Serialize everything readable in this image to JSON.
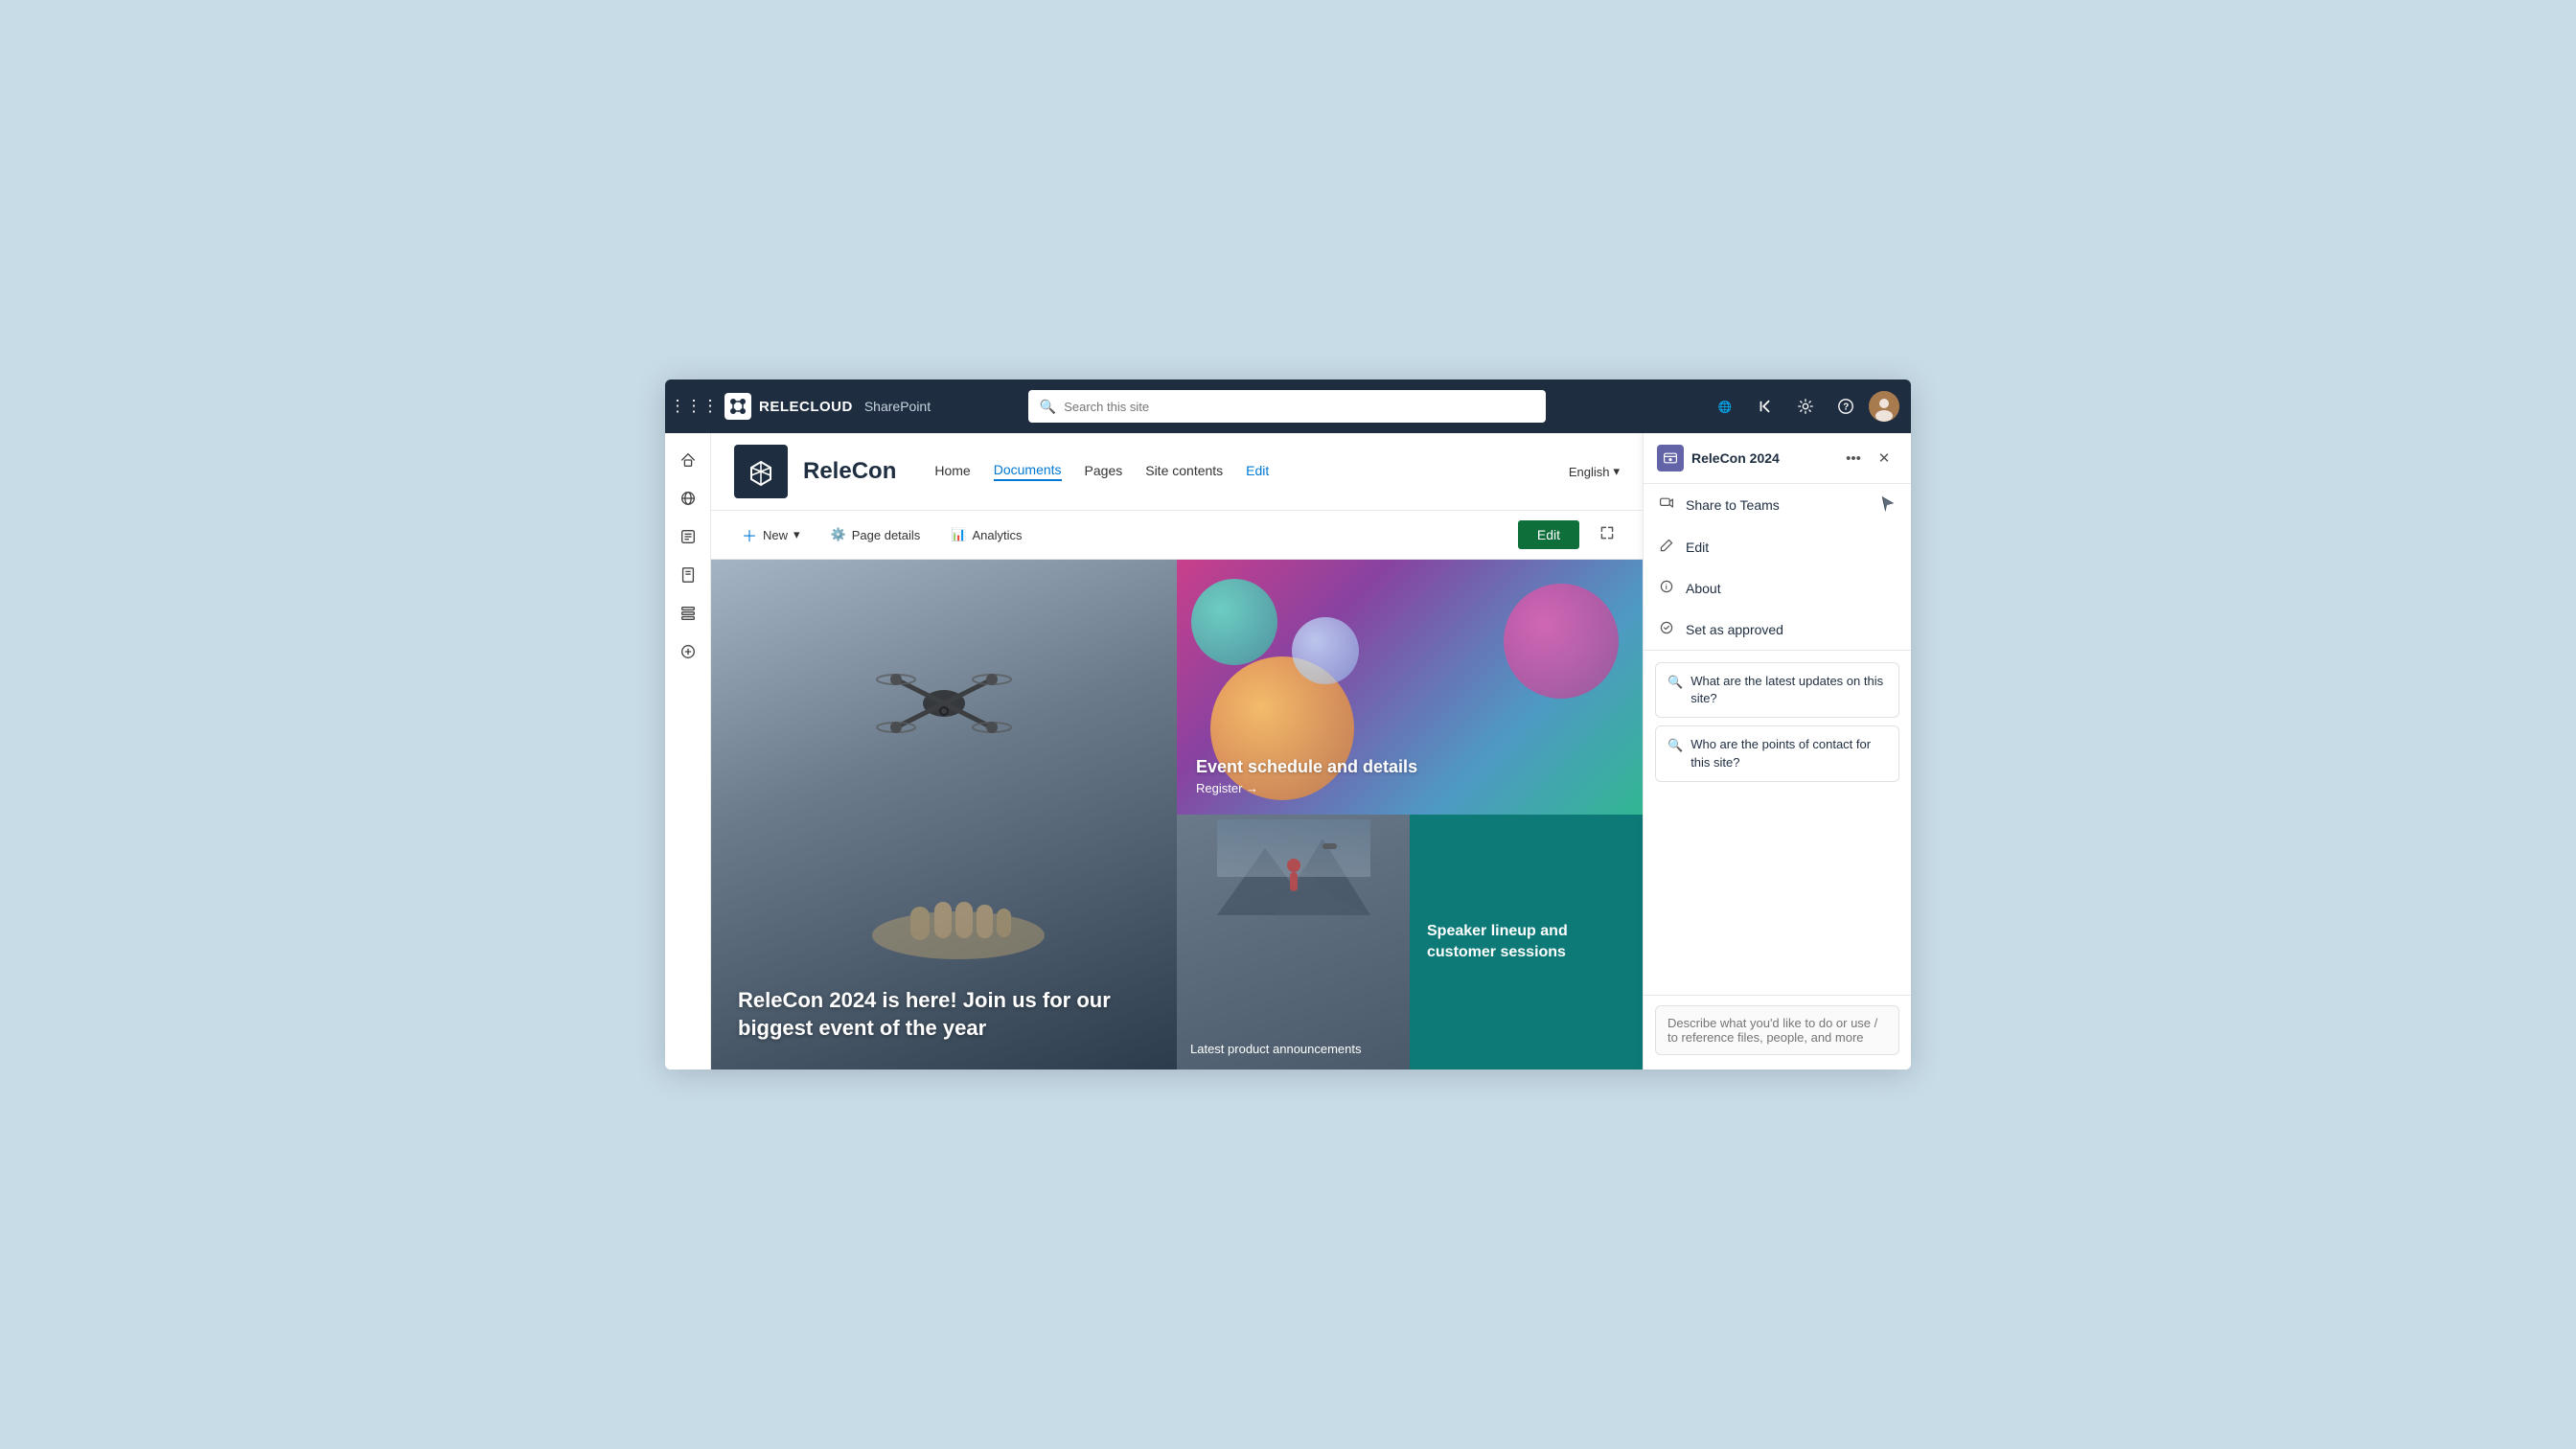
{
  "app": {
    "title": "ReleCon 2024",
    "brand": "RELECLOUD",
    "sharepoint_label": "SharePoint"
  },
  "topnav": {
    "search_placeholder": "Search this site",
    "icons": [
      "grid-waffle",
      "translate",
      "back",
      "settings",
      "help",
      "profile"
    ]
  },
  "sidebar": {
    "items": [
      "home",
      "globe",
      "document",
      "page",
      "list",
      "add"
    ]
  },
  "site": {
    "logo_alt": "ReleCon",
    "title": "ReleCon",
    "nav_items": [
      {
        "label": "Home",
        "active": false
      },
      {
        "label": "Documents",
        "active": true
      },
      {
        "label": "Pages",
        "active": false
      },
      {
        "label": "Site contents",
        "active": false
      },
      {
        "label": "Edit",
        "active": false,
        "style": "link"
      }
    ],
    "language": "English"
  },
  "toolbar": {
    "new_label": "New",
    "page_details_label": "Page details",
    "analytics_label": "Analytics",
    "edit_label": "Edit"
  },
  "hero": {
    "left_title": "ReleCon 2024 is here! Join us for our biggest event of the year",
    "top_right_title": "Event schedule and details",
    "top_right_link": "Register →",
    "bottom_left_title": "Latest product announcements",
    "bottom_right_title": "Speaker lineup and customer sessions"
  },
  "panel": {
    "title": "ReleCon 2024",
    "menu_items": [
      {
        "label": "Share to Teams",
        "icon": "share-teams"
      },
      {
        "label": "Edit",
        "icon": "edit"
      },
      {
        "label": "About",
        "icon": "info"
      },
      {
        "label": "Set as approved",
        "icon": "approved"
      }
    ],
    "suggestions": [
      "What are the latest updates on this site?",
      "Who are the points of contact for this site?"
    ],
    "input_placeholder": "Describe what you'd like to do or use / to reference files, people, and more"
  },
  "colors": {
    "teal_dark": "#1e2d40",
    "accent_blue": "#0078d4",
    "accent_green": "#0e6f3a",
    "teal_medium": "#0e7a78",
    "teams_purple": "#6264a7"
  }
}
